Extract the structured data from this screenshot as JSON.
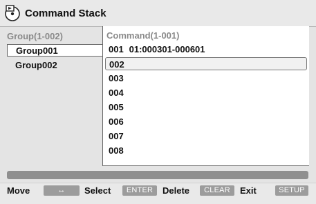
{
  "title": "Command Stack",
  "groups": {
    "header": "Group(1-002)",
    "items": [
      "Group001",
      "Group002"
    ]
  },
  "commands": {
    "header": "Command(1-001)",
    "rows": [
      {
        "num": "001",
        "value": "01:000301-000601"
      },
      {
        "num": "002",
        "value": ""
      },
      {
        "num": "003",
        "value": ""
      },
      {
        "num": "004",
        "value": ""
      },
      {
        "num": "005",
        "value": ""
      },
      {
        "num": "006",
        "value": ""
      },
      {
        "num": "007",
        "value": ""
      },
      {
        "num": "008",
        "value": ""
      }
    ]
  },
  "help": {
    "move_label": "Move",
    "move_key": "↔",
    "select_label": "Select",
    "select_key": "ENTER",
    "delete_label": "Delete",
    "delete_key": "CLEAR",
    "exit_label": "Exit",
    "exit_key": "SETUP"
  },
  "icons": {
    "title": "command-stack-icon",
    "move": "four-way-arrow-icon"
  }
}
